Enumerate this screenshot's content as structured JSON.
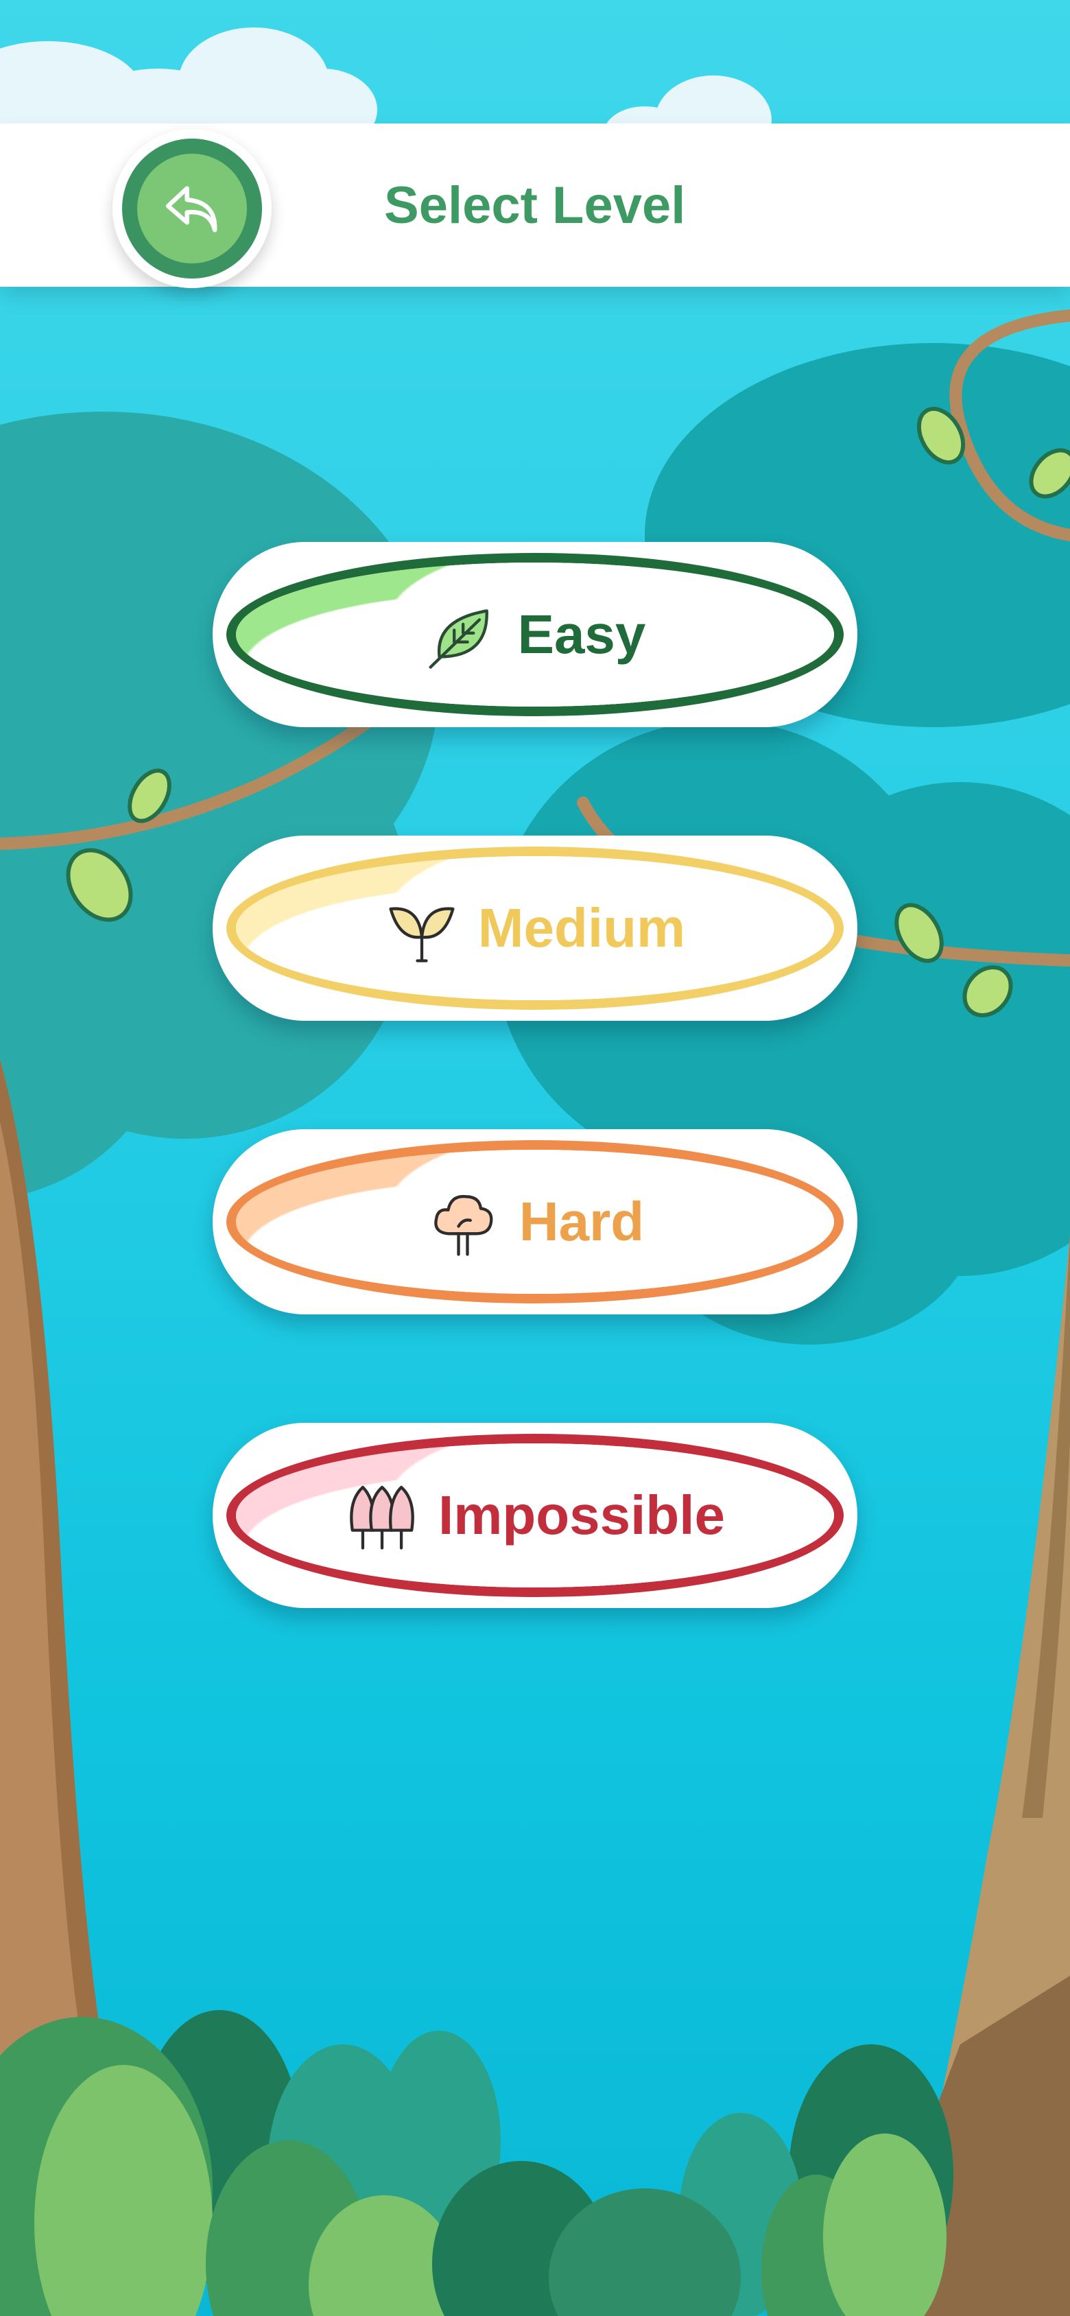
{
  "header": {
    "title": "Select Level",
    "back_icon": "back-arrow-icon"
  },
  "levels": [
    {
      "label": "Easy",
      "icon": "leaf-icon",
      "color": "#1f6b3a"
    },
    {
      "label": "Medium",
      "icon": "sprout-icon",
      "color": "#f0c95a"
    },
    {
      "label": "Hard",
      "icon": "tree-icon",
      "color": "#eda14a"
    },
    {
      "label": "Impossible",
      "icon": "forest-icon",
      "color": "#c32e3c"
    }
  ],
  "colors": {
    "sky": "#26cde5",
    "header_title": "#3c9a62",
    "back_button": "#7cc775"
  }
}
